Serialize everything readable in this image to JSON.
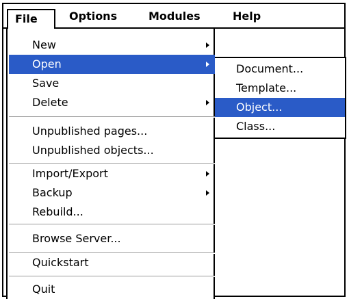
{
  "menubar": {
    "items": [
      {
        "label": "File"
      },
      {
        "label": "Options"
      },
      {
        "label": "Modules"
      },
      {
        "label": "Help"
      }
    ]
  },
  "file_menu": {
    "items": [
      {
        "label": "New",
        "has_submenu": true
      },
      {
        "label": "Open",
        "has_submenu": true,
        "highlighted": true
      },
      {
        "label": "Save",
        "has_submenu": false
      },
      {
        "label": "Delete",
        "has_submenu": true
      },
      {
        "label": "Unpublished pages...",
        "has_submenu": false
      },
      {
        "label": "Unpublished objects...",
        "has_submenu": false
      },
      {
        "label": "Import/Export",
        "has_submenu": true
      },
      {
        "label": "Backup",
        "has_submenu": true
      },
      {
        "label": "Rebuild...",
        "has_submenu": false
      },
      {
        "label": "Browse Server...",
        "has_submenu": false
      },
      {
        "label": "Quickstart",
        "has_submenu": false
      },
      {
        "label": "Quit",
        "has_submenu": false
      }
    ]
  },
  "open_submenu": {
    "items": [
      {
        "label": "Document..."
      },
      {
        "label": "Template..."
      },
      {
        "label": "Object...",
        "highlighted": true
      },
      {
        "label": "Class..."
      }
    ]
  },
  "colors": {
    "highlight": "#2a5bc7",
    "separator": "#9a9a9a"
  }
}
